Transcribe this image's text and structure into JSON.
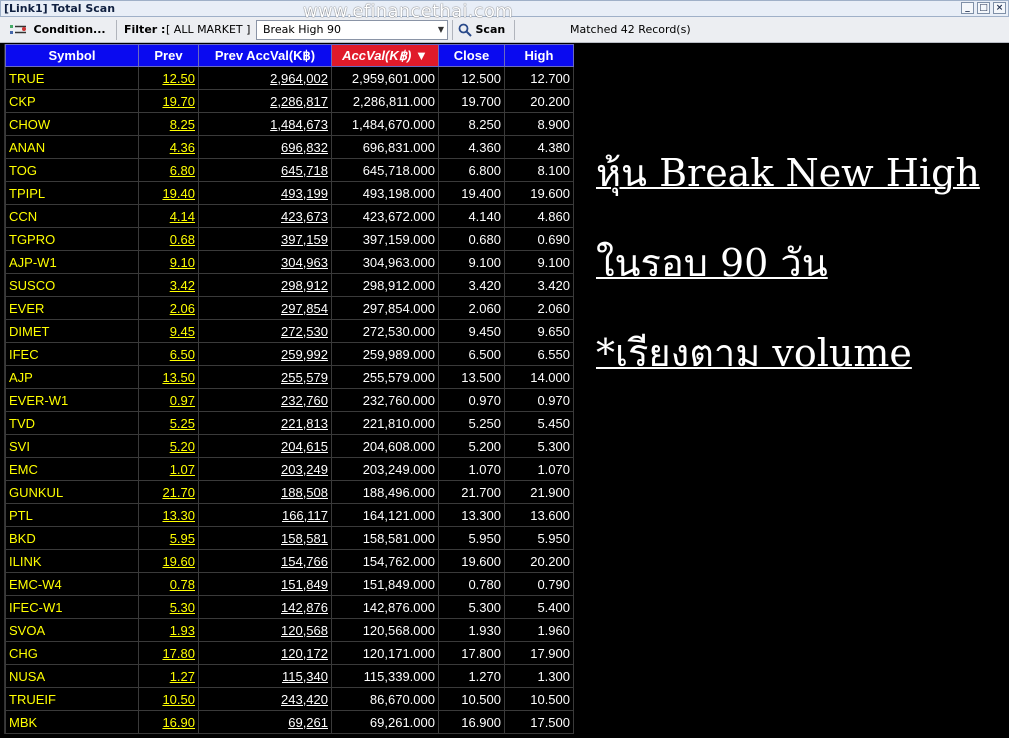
{
  "window": {
    "title": "[Link1] Total Scan",
    "min": "_",
    "max": "□",
    "close": "×"
  },
  "watermark": "www.efinancethai.com",
  "toolbar": {
    "condition_label": "Condition...",
    "filter_label": "Filter :",
    "filter_value": "[ ALL MARKET ]",
    "scan_type": "Break High 90",
    "scan_label": "Scan",
    "status": "Matched 42 Record(s)"
  },
  "table": {
    "columns": [
      "Symbol",
      "Prev",
      "Prev AccVal(K฿)",
      "AccVal(K฿)",
      "Close",
      "High"
    ],
    "sorted_column_index": 3,
    "rows": [
      [
        "TRUE",
        "12.50",
        "2,964,002",
        "2,959,601.000",
        "12.500",
        "12.700"
      ],
      [
        "CKP",
        "19.70",
        "2,286,817",
        "2,286,811.000",
        "19.700",
        "20.200"
      ],
      [
        "CHOW",
        "8.25",
        "1,484,673",
        "1,484,670.000",
        "8.250",
        "8.900"
      ],
      [
        "ANAN",
        "4.36",
        "696,832",
        "696,831.000",
        "4.360",
        "4.380"
      ],
      [
        "TOG",
        "6.80",
        "645,718",
        "645,718.000",
        "6.800",
        "8.100"
      ],
      [
        "TPIPL",
        "19.40",
        "493,199",
        "493,198.000",
        "19.400",
        "19.600"
      ],
      [
        "CCN",
        "4.14",
        "423,673",
        "423,672.000",
        "4.140",
        "4.860"
      ],
      [
        "TGPRO",
        "0.68",
        "397,159",
        "397,159.000",
        "0.680",
        "0.690"
      ],
      [
        "AJP-W1",
        "9.10",
        "304,963",
        "304,963.000",
        "9.100",
        "9.100"
      ],
      [
        "SUSCO",
        "3.42",
        "298,912",
        "298,912.000",
        "3.420",
        "3.420"
      ],
      [
        "EVER",
        "2.06",
        "297,854",
        "297,854.000",
        "2.060",
        "2.060"
      ],
      [
        "DIMET",
        "9.45",
        "272,530",
        "272,530.000",
        "9.450",
        "9.650"
      ],
      [
        "IFEC",
        "6.50",
        "259,992",
        "259,989.000",
        "6.500",
        "6.550"
      ],
      [
        "AJP",
        "13.50",
        "255,579",
        "255,579.000",
        "13.500",
        "14.000"
      ],
      [
        "EVER-W1",
        "0.97",
        "232,760",
        "232,760.000",
        "0.970",
        "0.970"
      ],
      [
        "TVD",
        "5.25",
        "221,813",
        "221,810.000",
        "5.250",
        "5.450"
      ],
      [
        "SVI",
        "5.20",
        "204,615",
        "204,608.000",
        "5.200",
        "5.300"
      ],
      [
        "EMC",
        "1.07",
        "203,249",
        "203,249.000",
        "1.070",
        "1.070"
      ],
      [
        "GUNKUL",
        "21.70",
        "188,508",
        "188,496.000",
        "21.700",
        "21.900"
      ],
      [
        "PTL",
        "13.30",
        "166,117",
        "164,121.000",
        "13.300",
        "13.600"
      ],
      [
        "BKD",
        "5.95",
        "158,581",
        "158,581.000",
        "5.950",
        "5.950"
      ],
      [
        "ILINK",
        "19.60",
        "154,766",
        "154,762.000",
        "19.600",
        "20.200"
      ],
      [
        "EMC-W4",
        "0.78",
        "151,849",
        "151,849.000",
        "0.780",
        "0.790"
      ],
      [
        "IFEC-W1",
        "5.30",
        "142,876",
        "142,876.000",
        "5.300",
        "5.400"
      ],
      [
        "SVOA",
        "1.93",
        "120,568",
        "120,568.000",
        "1.930",
        "1.960"
      ],
      [
        "CHG",
        "17.80",
        "120,172",
        "120,171.000",
        "17.800",
        "17.900"
      ],
      [
        "NUSA",
        "1.27",
        "115,340",
        "115,339.000",
        "1.270",
        "1.300"
      ],
      [
        "TRUEIF",
        "10.50",
        "243,420",
        "86,670.000",
        "10.500",
        "10.500"
      ],
      [
        "MBK",
        "16.90",
        "69,261",
        "69,261.000",
        "16.900",
        "17.500"
      ]
    ]
  },
  "annotation": {
    "line1": "หุ้น Break New High",
    "line2": "ในรอบ 90 วัน",
    "line3": "*เรียงตาม volume"
  },
  "colors": {
    "header_bg": "#0a0af0",
    "sorted_header_bg": "#e01a2a",
    "symbol_text": "#ffff00",
    "value_text": "#ffffff",
    "background": "#000000"
  }
}
